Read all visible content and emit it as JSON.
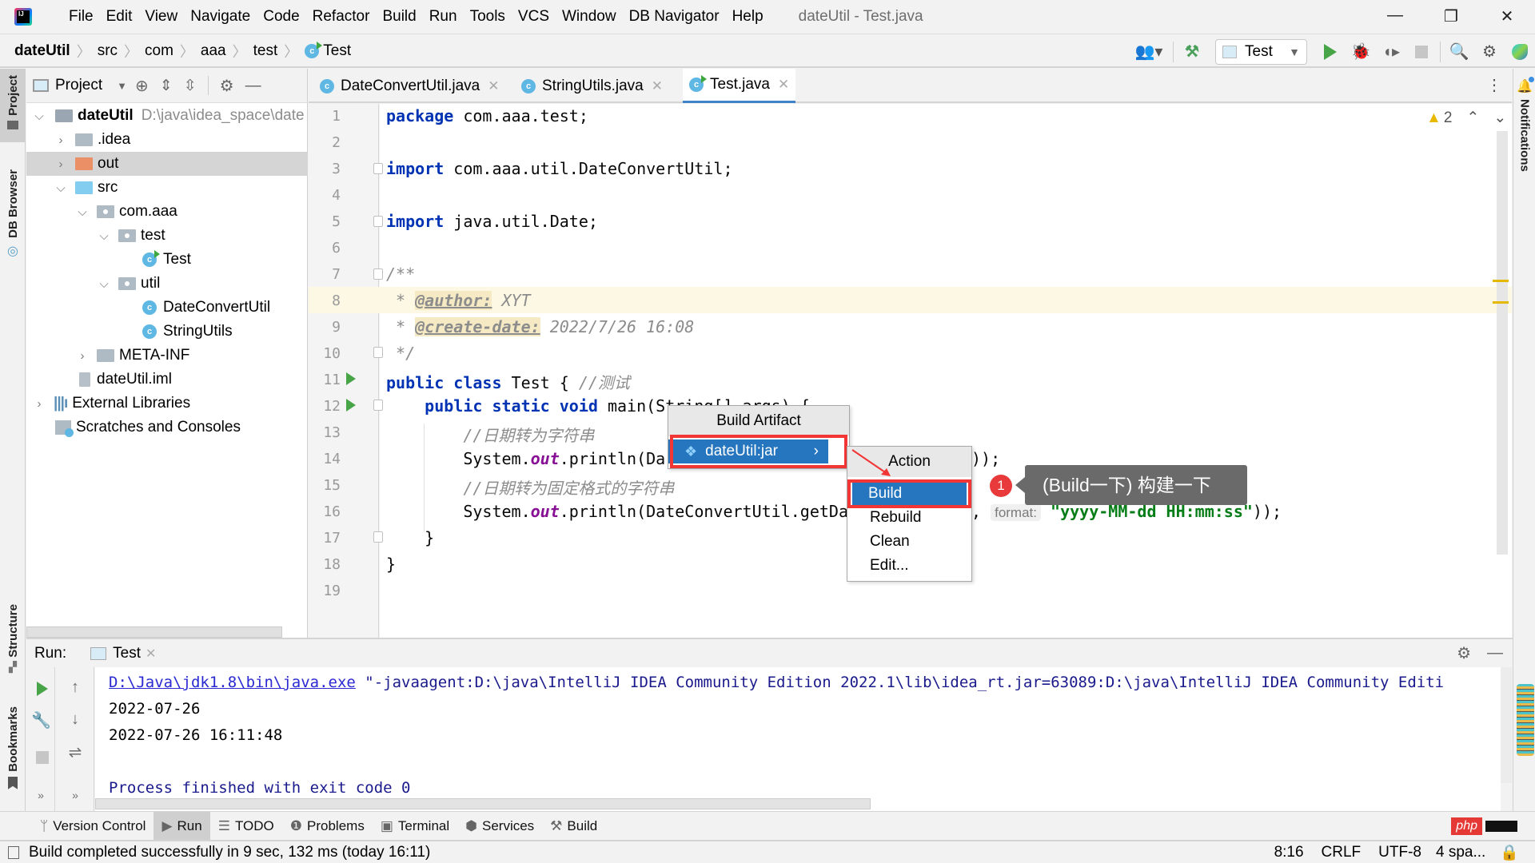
{
  "menubar": {
    "logo_text": "IJ",
    "items": [
      "File",
      "Edit",
      "View",
      "Navigate",
      "Code",
      "Refactor",
      "Build",
      "Run",
      "Tools",
      "VCS",
      "Window",
      "DB Navigator",
      "Help"
    ],
    "window_title": "dateUtil - Test.java",
    "controls": {
      "minimize": "—",
      "maximize": "❐",
      "close": "✕"
    }
  },
  "breadcrumb": [
    "dateUtil",
    "src",
    "com",
    "aaa",
    "test",
    "Test"
  ],
  "toolbar": {
    "run_config": "Test",
    "icons": [
      "vcs-user-icon",
      "build-hammer-icon",
      "run-icon",
      "debug-icon",
      "coverage-icon",
      "stop-icon",
      "search-icon",
      "settings-icon",
      "toolbox-icon"
    ]
  },
  "left_strip": {
    "project": "Project",
    "db_browser": "DB Browser",
    "structure": "Structure",
    "bookmarks": "Bookmarks"
  },
  "right_strip": {
    "notifications": "Notifications"
  },
  "project_panel": {
    "title": "Project",
    "tree": [
      {
        "label": "dateUtil",
        "path": "D:\\java\\idea_space\\date",
        "depth": 0,
        "expanded": true,
        "type": "module",
        "bold": true
      },
      {
        "label": ".idea",
        "depth": 1,
        "expanded": false,
        "type": "folder"
      },
      {
        "label": "out",
        "depth": 1,
        "expanded": false,
        "type": "folder-excluded",
        "selected": true
      },
      {
        "label": "src",
        "depth": 1,
        "expanded": true,
        "type": "folder-source"
      },
      {
        "label": "com.aaa",
        "depth": 2,
        "expanded": true,
        "type": "package"
      },
      {
        "label": "test",
        "depth": 3,
        "expanded": true,
        "type": "package"
      },
      {
        "label": "Test",
        "depth": 4,
        "type": "class-runnable"
      },
      {
        "label": "util",
        "depth": 3,
        "expanded": true,
        "type": "package"
      },
      {
        "label": "DateConvertUtil",
        "depth": 4,
        "type": "class"
      },
      {
        "label": "StringUtils",
        "depth": 4,
        "type": "class"
      },
      {
        "label": "META-INF",
        "depth": 2,
        "expanded": false,
        "type": "folder"
      },
      {
        "label": "dateUtil.iml",
        "depth": 1,
        "type": "file"
      },
      {
        "label": "External Libraries",
        "depth": 0,
        "expanded": false,
        "type": "library"
      },
      {
        "label": "Scratches and Consoles",
        "depth": 0,
        "type": "scratches"
      }
    ]
  },
  "editor": {
    "tabs": [
      {
        "label": "DateConvertUtil.java",
        "active": false
      },
      {
        "label": "StringUtils.java",
        "active": false
      },
      {
        "label": "Test.java",
        "active": true
      }
    ],
    "warnings_count": "2",
    "line_numbers": [
      "1",
      "2",
      "3",
      "4",
      "5",
      "6",
      "7",
      "8",
      "9",
      "10",
      "11",
      "12",
      "13",
      "14",
      "15",
      "16",
      "17",
      "18",
      "19"
    ],
    "code": {
      "l1_kw": "package",
      "l1": " com.aaa.test;",
      "l3_kw": "import",
      "l3": " com.aaa.util.DateConvertUtil;",
      "l5_kw": "import",
      "l5": " java.util.Date;",
      "l7": "/**",
      "l8_pre": " * ",
      "l8_tag": "@author:",
      "l8": " XYT",
      "l9_pre": " * ",
      "l9_tag": "@create-date:",
      "l9": " 2022/7/26 16:08",
      "l10": " */",
      "l11_kw": "public class",
      "l11": " Test { ",
      "l11_cm": "//测试",
      "l12_indent": "    ",
      "l12_kw": "public static void",
      "l12": " main(String[] args) {",
      "l13": "        //日期转为字符串",
      "l14_a": "        System.",
      "l14_b": "out",
      "l14_c": ".println(Da",
      "l14_tail": "));",
      "l15": "        //日期转为固定格式的字符串",
      "l16_a": "        System.",
      "l16_b": "out",
      "l16_c": ".println(DateConvertUtil.getDa",
      "l16_comma": ",",
      "l16_hint": "format:",
      "l16_str": "\"yyyy-MM-dd HH:mm:ss\"",
      "l16_tail": "));",
      "l17": "    }",
      "l18": "}"
    }
  },
  "build_artifact_popup": {
    "title": "Build Artifact",
    "items": [
      {
        "label": "dateUtil:jar",
        "selected": true
      }
    ]
  },
  "action_popup": {
    "title": "Action",
    "items": [
      {
        "label": "Build",
        "selected": true
      },
      {
        "label": "Rebuild"
      },
      {
        "label": "Clean"
      },
      {
        "label": "Edit..."
      }
    ]
  },
  "annotation": {
    "badge": "1",
    "text": "(Build一下) 构建一下"
  },
  "run_panel": {
    "label": "Run:",
    "tab": "Test",
    "console": {
      "cmd_link": "D:\\Java\\jdk1.8\\bin\\java.exe",
      "cmd_rest": " \"-javaagent:D:\\java\\IntelliJ IDEA Community Edition 2022.1\\lib\\idea_rt.jar=63089:D:\\java\\IntelliJ IDEA Community Editi",
      "out1": "2022-07-26",
      "out2": "2022-07-26 16:11:48",
      "exit": "Process finished with exit code 0"
    }
  },
  "tool_tabs": [
    {
      "label": "Version Control",
      "icon": "vcs-branch-icon"
    },
    {
      "label": "Run",
      "icon": "run-icon",
      "active": true
    },
    {
      "label": "TODO",
      "icon": "list-icon"
    },
    {
      "label": "Problems",
      "icon": "problems-icon"
    },
    {
      "label": "Terminal",
      "icon": "terminal-icon"
    },
    {
      "label": "Services",
      "icon": "services-icon"
    },
    {
      "label": "Build",
      "icon": "hammer-icon"
    }
  ],
  "statusbar": {
    "message": "Build completed successfully in 9 sec, 132 ms (today 16:11)",
    "position": "8:16",
    "line_sep": "CRLF",
    "encoding": "UTF-8",
    "indent": "4 spa...",
    "watermark": "php"
  },
  "colors": {
    "accent": "#2675bf",
    "highlight_red": "#f23535",
    "run_green": "#47a447",
    "keyword": "#0033b3",
    "string": "#067d17"
  }
}
